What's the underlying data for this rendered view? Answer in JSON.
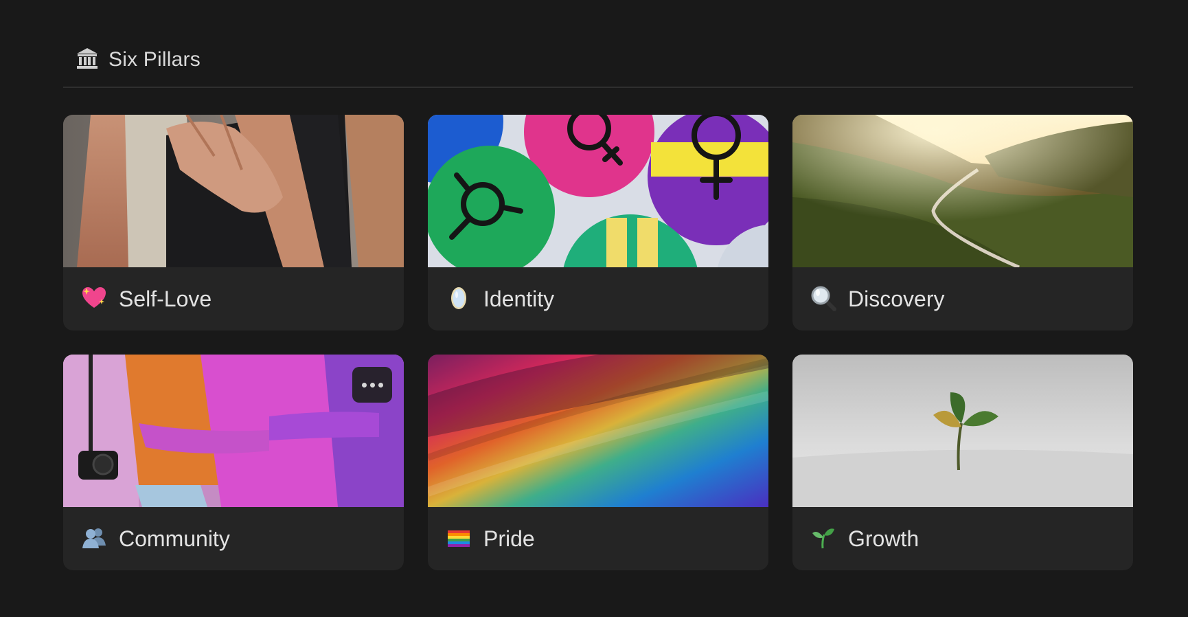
{
  "header": {
    "icon": "classical-building-icon",
    "title": "Six Pillars"
  },
  "cards": [
    {
      "label": "Self-Love",
      "emoji": "sparkling-heart-icon",
      "image": "hand-on-chest-photo"
    },
    {
      "label": "Identity",
      "emoji": "mirror-icon",
      "image": "gender-pins-photo"
    },
    {
      "label": "Discovery",
      "emoji": "magnifying-glass-icon",
      "image": "mountain-road-photo"
    },
    {
      "label": "Community",
      "emoji": "busts-in-silhouette-icon",
      "image": "group-hug-photo",
      "has_more_button": true
    },
    {
      "label": "Pride",
      "emoji": "rainbow-flag-icon",
      "image": "rainbow-chalk-photo"
    },
    {
      "label": "Growth",
      "emoji": "seedling-icon",
      "image": "sprout-in-sand-photo"
    }
  ],
  "colors": {
    "background": "#191919",
    "card": "#252525",
    "text": "#e3e3e3",
    "divider": "#2f2f2f"
  }
}
